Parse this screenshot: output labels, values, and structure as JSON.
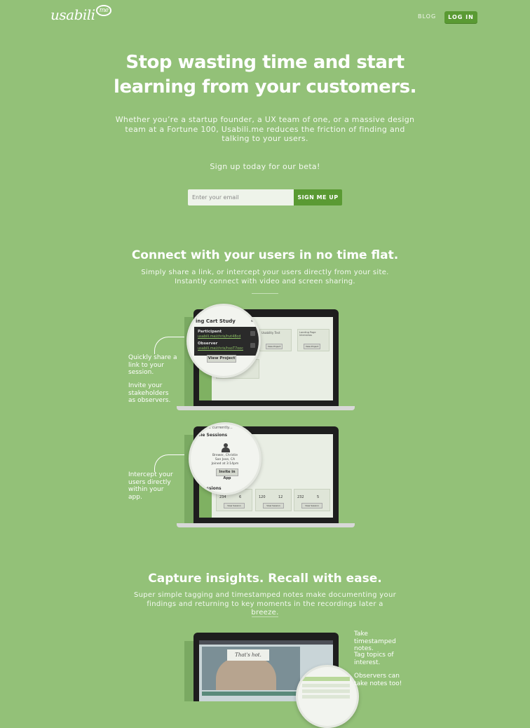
{
  "header": {
    "logo_text": "usabili",
    "logo_bubble": "me",
    "blog_label": "BLOG",
    "login_label": "LOG IN"
  },
  "hero": {
    "headline_line1": "Stop wasting time and start",
    "headline_line2": "learning from your customers.",
    "subtext": "Whether you’re a startup founder, a UX team of one, or a massive design team at a Fortune 100, Usabili.me reduces the friction of finding and talking to your users.",
    "beta_text": "Sign up today for our beta!",
    "email_placeholder": "Enter your email",
    "signup_label": "SIGN ME UP"
  },
  "section1": {
    "title": "Connect with your users in no time flat.",
    "description": "Simply share a link, or intercept your users directly from your site. Instantly connect with video and screen sharing.",
    "note1a": "Quickly share a link to your session.",
    "note1b": "Invite your stakeholders as observers.",
    "note2": "Intercept your users directly within your app.",
    "mock1": {
      "study_title": "ing Cart Study",
      "participant_label": "Participant",
      "participant_link": "usabili.me/chris/hvt48cd",
      "observer_label": "Observer",
      "observer_link": "usabili.me/chris/hsoT7ooc",
      "view_project": "View Project",
      "card1": "Usability Test",
      "card2": "Landing Page Interviews"
    },
    "mock2": {
      "header": "le currently...",
      "available": "able Sessions",
      "user_name": "Brewer, Christie",
      "user_location": "San Jose, CA",
      "user_joined": "Joined at 3:14pm",
      "invite_label": "Invite in App",
      "sessions": "Sessions",
      "stat1": "234",
      "stat2": "6",
      "stat3": "120",
      "stat4": "12",
      "stat5": "232",
      "stat6": "5",
      "view_session": "View Session"
    }
  },
  "section2": {
    "title": "Capture insights. Recall with ease.",
    "description": "Super simple tagging and timestamped notes make documenting your findings and returning to key moments in the recordings later a breeze.",
    "note1": "Take timestamped notes.",
    "note2": "Tag topics of interest.",
    "note3": "Observers can take notes too!",
    "mock_slide": "That's hot."
  },
  "colors": {
    "background": "#93c178",
    "button": "#5a9a33"
  }
}
